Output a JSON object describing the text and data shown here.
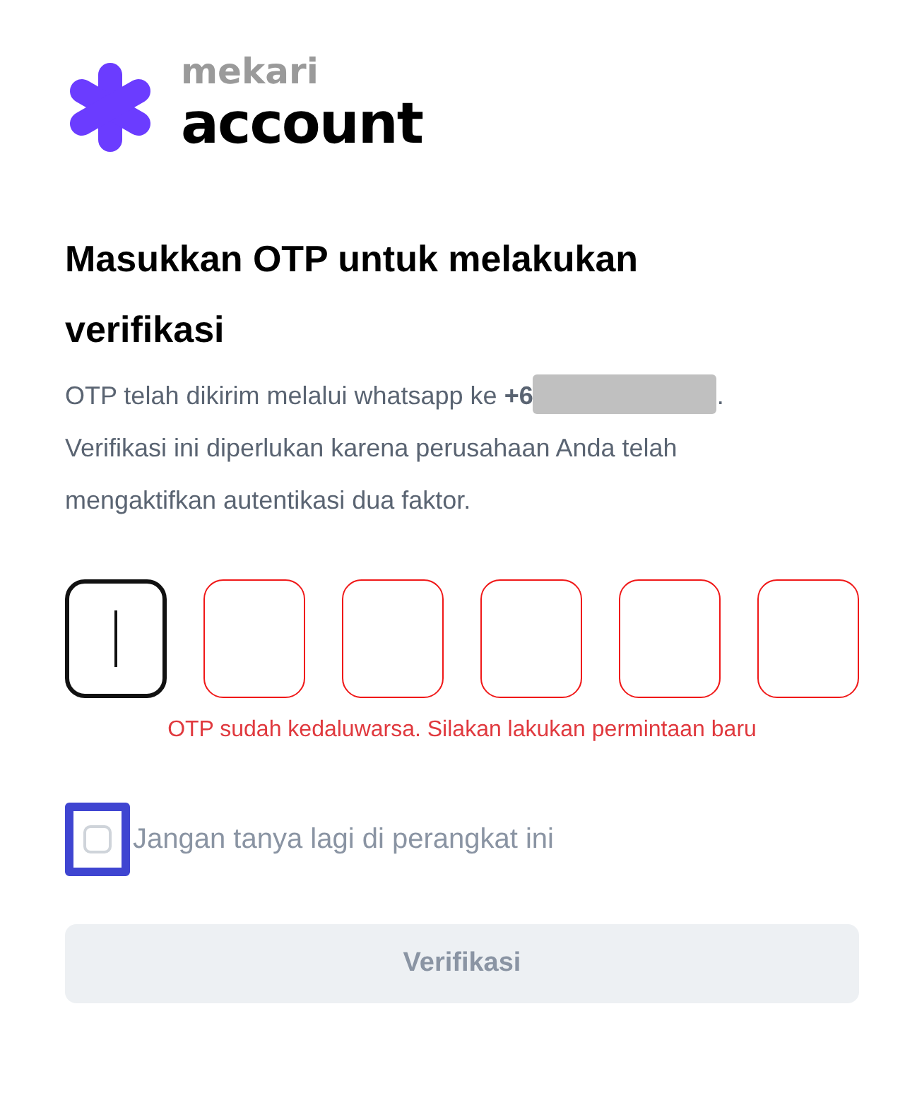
{
  "logo": {
    "brand": "mekari",
    "product": "account"
  },
  "heading": "Masukkan OTP untuk melakukan verifikasi",
  "description": {
    "before": "OTP telah dikirim melalui whatsapp ke **+6**",
    "redacted": true,
    "after": ".",
    "note": "Verifikasi ini diperlukan karena perusahaan Anda telah mengaktifkan autentikasi dua faktor."
  },
  "otp_fields": [
    {
      "focused": true,
      "error": false
    },
    {
      "focused": false,
      "error": true
    },
    {
      "focused": false,
      "error": true
    },
    {
      "focused": false,
      "error": true
    },
    {
      "focused": false,
      "error": true
    },
    {
      "focused": false,
      "error": true
    }
  ],
  "error_message": "OTP sudah kedaluwarsa. Silakan lakukan permintaan baru",
  "remember_device": {
    "label": "Jangan tanya lagi di perangkat ini",
    "checked": false,
    "focused": true
  },
  "submit_button": {
    "label": "Verifikasi",
    "disabled": true
  }
}
